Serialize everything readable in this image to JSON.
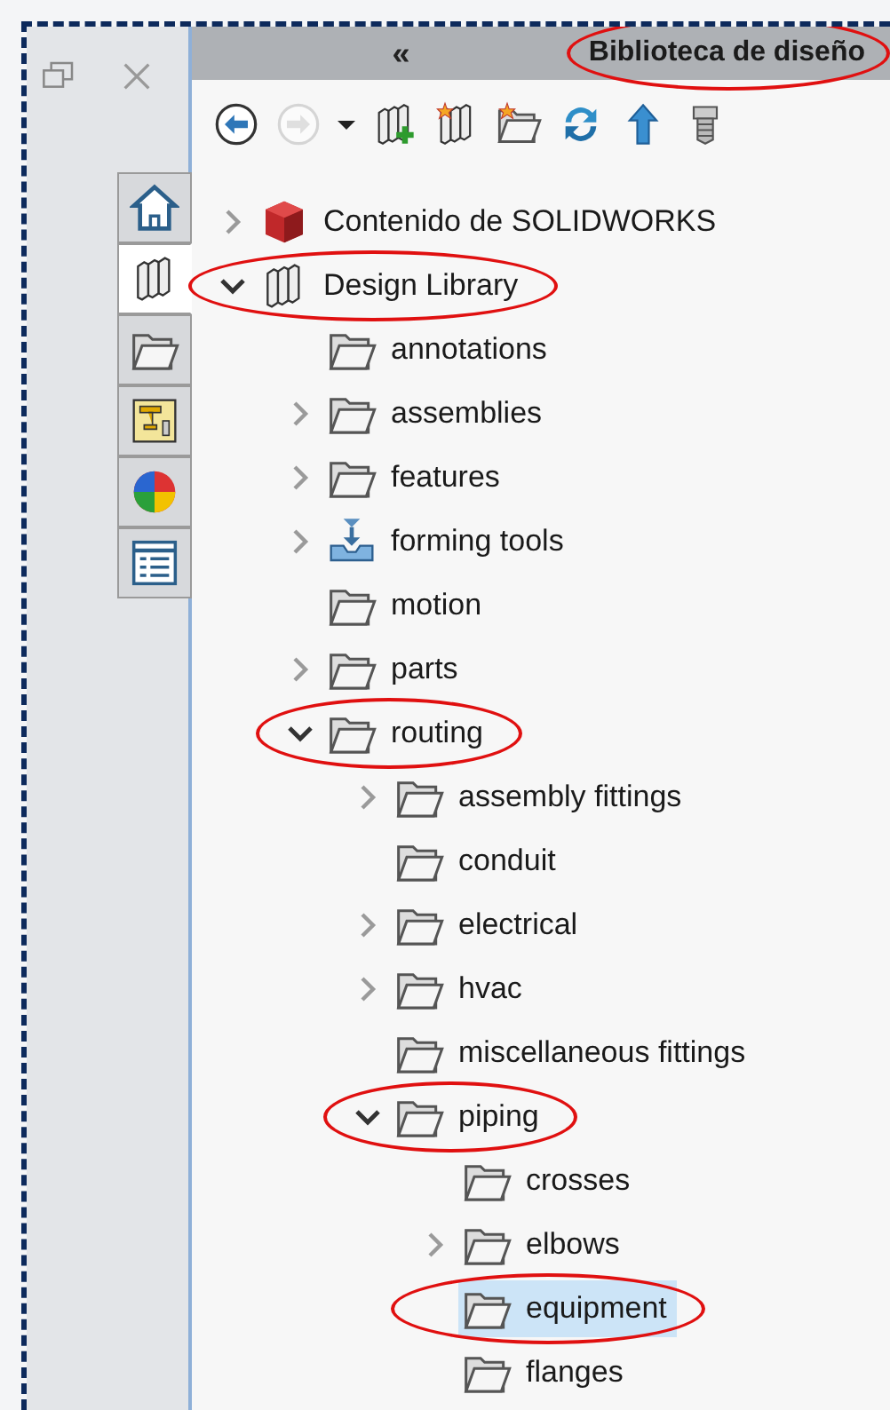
{
  "header": {
    "collapse": "«",
    "title": "Biblioteca de diseño",
    "circled": true
  },
  "toolbar": [
    {
      "kind": "back",
      "disabled": false
    },
    {
      "kind": "forward",
      "disabled": true
    },
    {
      "kind": "dropdown",
      "disabled": false
    },
    {
      "kind": "add-library",
      "disabled": false
    },
    {
      "kind": "new-library",
      "disabled": false
    },
    {
      "kind": "new-folder",
      "disabled": false
    },
    {
      "kind": "refresh",
      "disabled": false
    },
    {
      "kind": "up",
      "disabled": false
    },
    {
      "kind": "toolbox",
      "disabled": false
    }
  ],
  "side_tabs": [
    {
      "kind": "home",
      "selected": false
    },
    {
      "kind": "library",
      "selected": true
    },
    {
      "kind": "folder",
      "selected": false
    },
    {
      "kind": "palette",
      "selected": false
    },
    {
      "kind": "appearance",
      "selected": false
    },
    {
      "kind": "properties",
      "selected": false
    }
  ],
  "tree": [
    {
      "label": "Contenido de SOLIDWORKS",
      "kind": "solidworks",
      "has_children": true,
      "expanded": false,
      "selected": false,
      "circled": false
    },
    {
      "label": "Design Library",
      "kind": "library",
      "has_children": true,
      "expanded": true,
      "selected": false,
      "circled": true,
      "children": [
        {
          "label": "annotations",
          "kind": "folder",
          "selected": false,
          "circled": false
        },
        {
          "label": "assemblies",
          "kind": "folder",
          "has_children": true,
          "expanded": false,
          "selected": false,
          "circled": false
        },
        {
          "label": "features",
          "kind": "folder",
          "has_children": true,
          "expanded": false,
          "selected": false,
          "circled": false
        },
        {
          "label": "forming tools",
          "kind": "forming",
          "has_children": true,
          "expanded": false,
          "selected": false,
          "circled": false
        },
        {
          "label": "motion",
          "kind": "folder",
          "selected": false,
          "circled": false
        },
        {
          "label": "parts",
          "kind": "folder",
          "has_children": true,
          "expanded": false,
          "selected": false,
          "circled": false
        },
        {
          "label": "routing",
          "kind": "folder",
          "has_children": true,
          "expanded": true,
          "selected": false,
          "circled": true,
          "children": [
            {
              "label": "assembly fittings",
              "kind": "folder",
              "has_children": true,
              "expanded": false,
              "selected": false,
              "circled": false
            },
            {
              "label": "conduit",
              "kind": "folder",
              "selected": false,
              "circled": false
            },
            {
              "label": "electrical",
              "kind": "folder",
              "has_children": true,
              "expanded": false,
              "selected": false,
              "circled": false
            },
            {
              "label": "hvac",
              "kind": "folder",
              "has_children": true,
              "expanded": false,
              "selected": false,
              "circled": false
            },
            {
              "label": "miscellaneous fittings",
              "kind": "folder",
              "selected": false,
              "circled": false
            },
            {
              "label": "piping",
              "kind": "folder",
              "has_children": true,
              "expanded": true,
              "selected": false,
              "circled": true,
              "children": [
                {
                  "label": "crosses",
                  "kind": "folder",
                  "selected": false,
                  "circled": false
                },
                {
                  "label": "elbows",
                  "kind": "folder",
                  "has_children": true,
                  "expanded": false,
                  "selected": false,
                  "circled": false
                },
                {
                  "label": "equipment",
                  "kind": "folder",
                  "selected": true,
                  "circled": true
                },
                {
                  "label": "flanges",
                  "kind": "folder",
                  "selected": false,
                  "circled": false
                }
              ]
            }
          ]
        }
      ]
    }
  ]
}
